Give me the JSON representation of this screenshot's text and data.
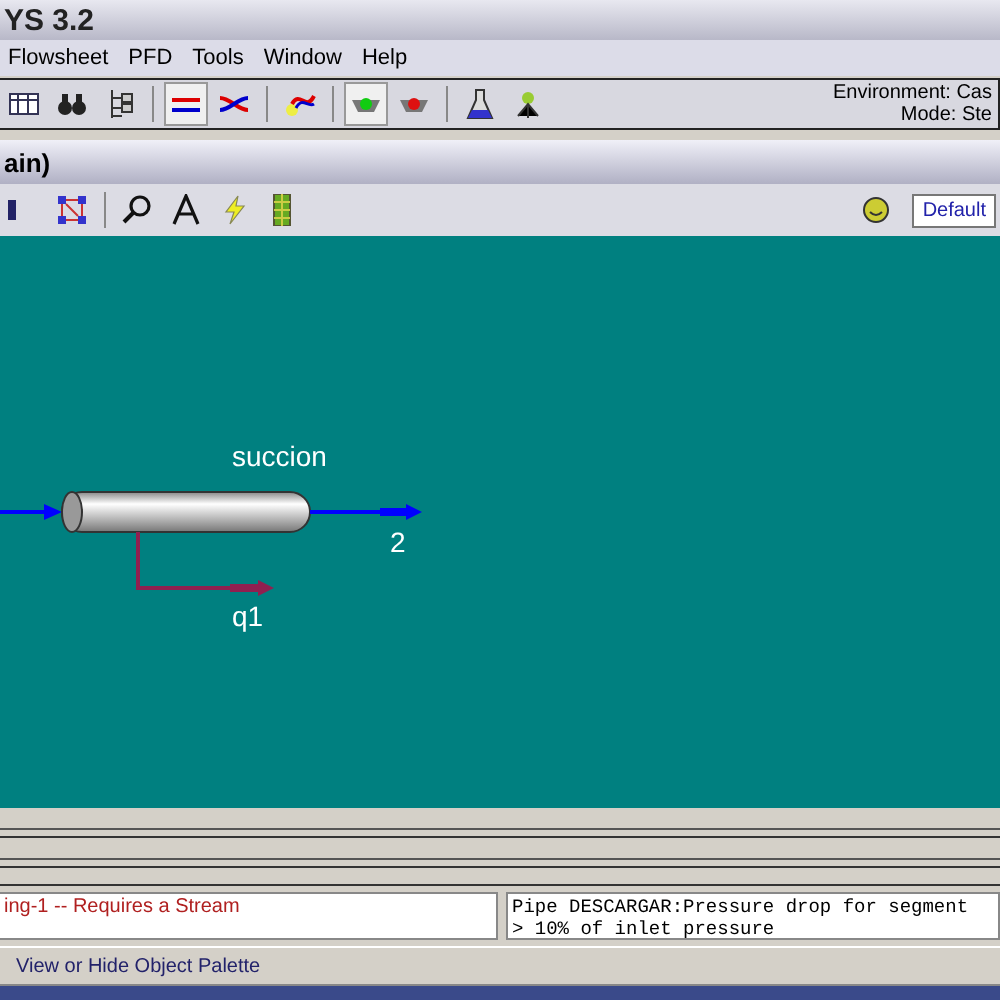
{
  "window": {
    "title": "YS 3.2"
  },
  "menu": [
    "Flowsheet",
    "PFD",
    "Tools",
    "Window",
    "Help"
  ],
  "environment": {
    "environment": "Environment: Cas",
    "mode": "Mode: Ste"
  },
  "pfd_window": {
    "title": "ain)"
  },
  "pfd_toolbar": {
    "scheme": "Default"
  },
  "flowsheet": {
    "unit": "succion",
    "outlet": "2",
    "energy": "q1"
  },
  "messages": {
    "left": "ing-1 -- Requires a Stream",
    "right": [
      "Pipe DESCARGAR:Pressure drop for segment",
      "> 10% of inlet pressure"
    ]
  },
  "status_bar": "View or Hide Object Palette"
}
